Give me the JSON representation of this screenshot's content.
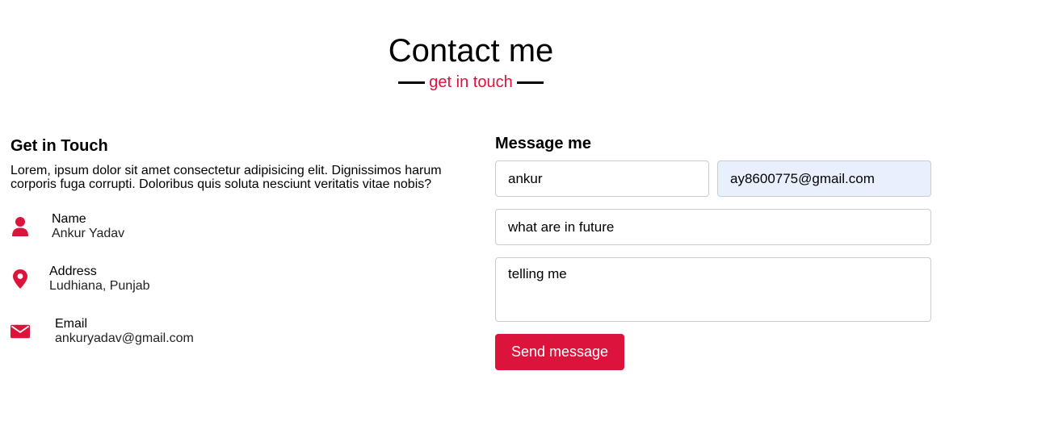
{
  "header": {
    "title": "Contact me",
    "subtitle": "get in touch"
  },
  "get_in_touch": {
    "heading": "Get in Touch",
    "description": "Lorem, ipsum dolor sit amet consectetur adipisicing elit. Dignissimos harum corporis fuga corrupti. Doloribus quis soluta nesciunt veritatis vitae nobis?",
    "items": [
      {
        "icon": "user-icon",
        "title": "Name",
        "value": "Ankur Yadav"
      },
      {
        "icon": "map-pin-icon",
        "title": "Address",
        "value": "Ludhiana, Punjab"
      },
      {
        "icon": "envelope-icon",
        "title": "Email",
        "value": "ankuryadav@gmail.com"
      }
    ]
  },
  "message_form": {
    "heading": "Message me",
    "name_value": "ankur",
    "email_value": "ay8600775@gmail.com",
    "subject_value": "what are in future",
    "message_value": "telling me",
    "send_label": "Send message"
  },
  "colors": {
    "accent": "#dc143c",
    "autofill_bg": "#e8f0fe",
    "border": "#cccccc"
  }
}
